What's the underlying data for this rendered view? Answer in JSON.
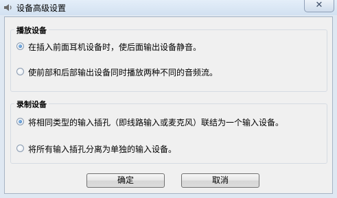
{
  "window": {
    "title": "设备高级设置",
    "close_glyph": "✕"
  },
  "playback": {
    "legend": "播放设备",
    "options": [
      {
        "label": "在插入前面耳机设备时，使后面输出设备静音。",
        "checked": true
      },
      {
        "label": "使前部和后部输出设备同时播放两种不同的音频流。",
        "checked": false
      }
    ]
  },
  "recording": {
    "legend": "录制设备",
    "options": [
      {
        "label": "将相同类型的输入插孔（即线路输入或麦克风）联结为一个输入设备。",
        "checked": true
      },
      {
        "label": "将所有输入插孔分离为单独的输入设备。",
        "checked": false
      }
    ]
  },
  "buttons": {
    "ok": "确定",
    "cancel": "取消"
  }
}
